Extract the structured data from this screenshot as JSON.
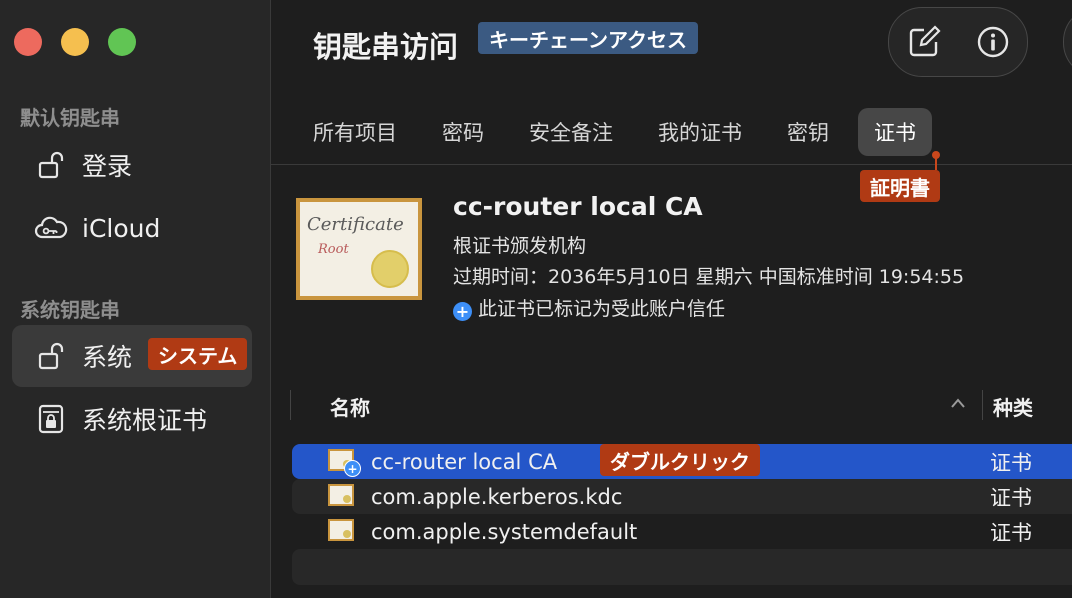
{
  "sidebar": {
    "default_section": "默认钥匙串",
    "system_section": "系统钥匙串",
    "items": [
      {
        "label": "登录",
        "icon": "lock-open-icon"
      },
      {
        "label": "iCloud",
        "icon": "cloud-key-icon"
      },
      {
        "label": "系统",
        "icon": "lock-open-icon"
      },
      {
        "label": "系统根证书",
        "icon": "lock-cabinet-icon"
      }
    ],
    "system_annotation": "システム"
  },
  "header": {
    "title": "钥匙串访问",
    "title_annotation": "キーチェーンアクセス",
    "compose_icon": "compose-icon",
    "info_icon": "info-icon"
  },
  "tabs": [
    {
      "label": "所有项目"
    },
    {
      "label": "密码"
    },
    {
      "label": "安全备注"
    },
    {
      "label": "我的证书"
    },
    {
      "label": "密钥"
    },
    {
      "label": "证书"
    }
  ],
  "tab_annotation": "証明書",
  "detail": {
    "icon_text": "Certificate",
    "icon_subtext": "Root",
    "name": "cc-router local CA",
    "kind": "根证书颁发机构",
    "expires": "过期时间：2036年5月10日 星期六 中国标准时间 19:54:55",
    "trust": "此证书已标记为受此账户信任"
  },
  "table": {
    "columns": {
      "name": "名称",
      "kind": "种类"
    },
    "rows": [
      {
        "name": "cc-router local CA",
        "kind": "证书"
      },
      {
        "name": "com.apple.kerberos.kdc",
        "kind": "证书"
      },
      {
        "name": "com.apple.systemdefault",
        "kind": "证书"
      }
    ],
    "row_annotation": "ダブルクリック"
  },
  "colors": {
    "selection": "#2456c9",
    "annotation_red": "#b03a14",
    "annotation_blue": "#3b5a82"
  }
}
